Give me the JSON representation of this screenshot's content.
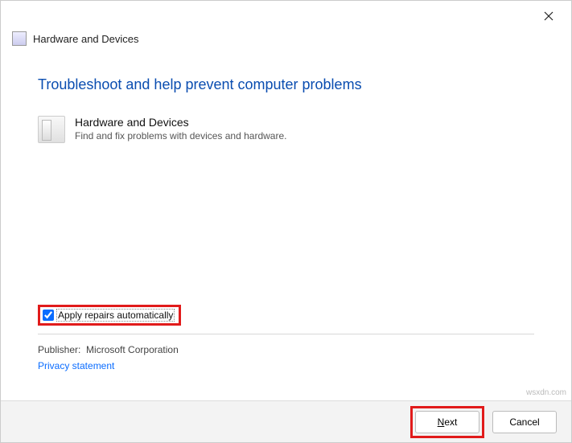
{
  "window": {
    "title": "Hardware and Devices"
  },
  "heading": "Troubleshoot and help prevent computer problems",
  "category": {
    "title": "Hardware and Devices",
    "description": "Find and fix problems with devices and hardware."
  },
  "checkbox": {
    "label": "Apply repairs automatically",
    "checked": true
  },
  "publisher": {
    "label": "Publisher:",
    "value": "Microsoft Corporation"
  },
  "privacy_link": "Privacy statement",
  "buttons": {
    "next": "Next",
    "cancel": "Cancel"
  },
  "attribution": "wsxdn.com"
}
